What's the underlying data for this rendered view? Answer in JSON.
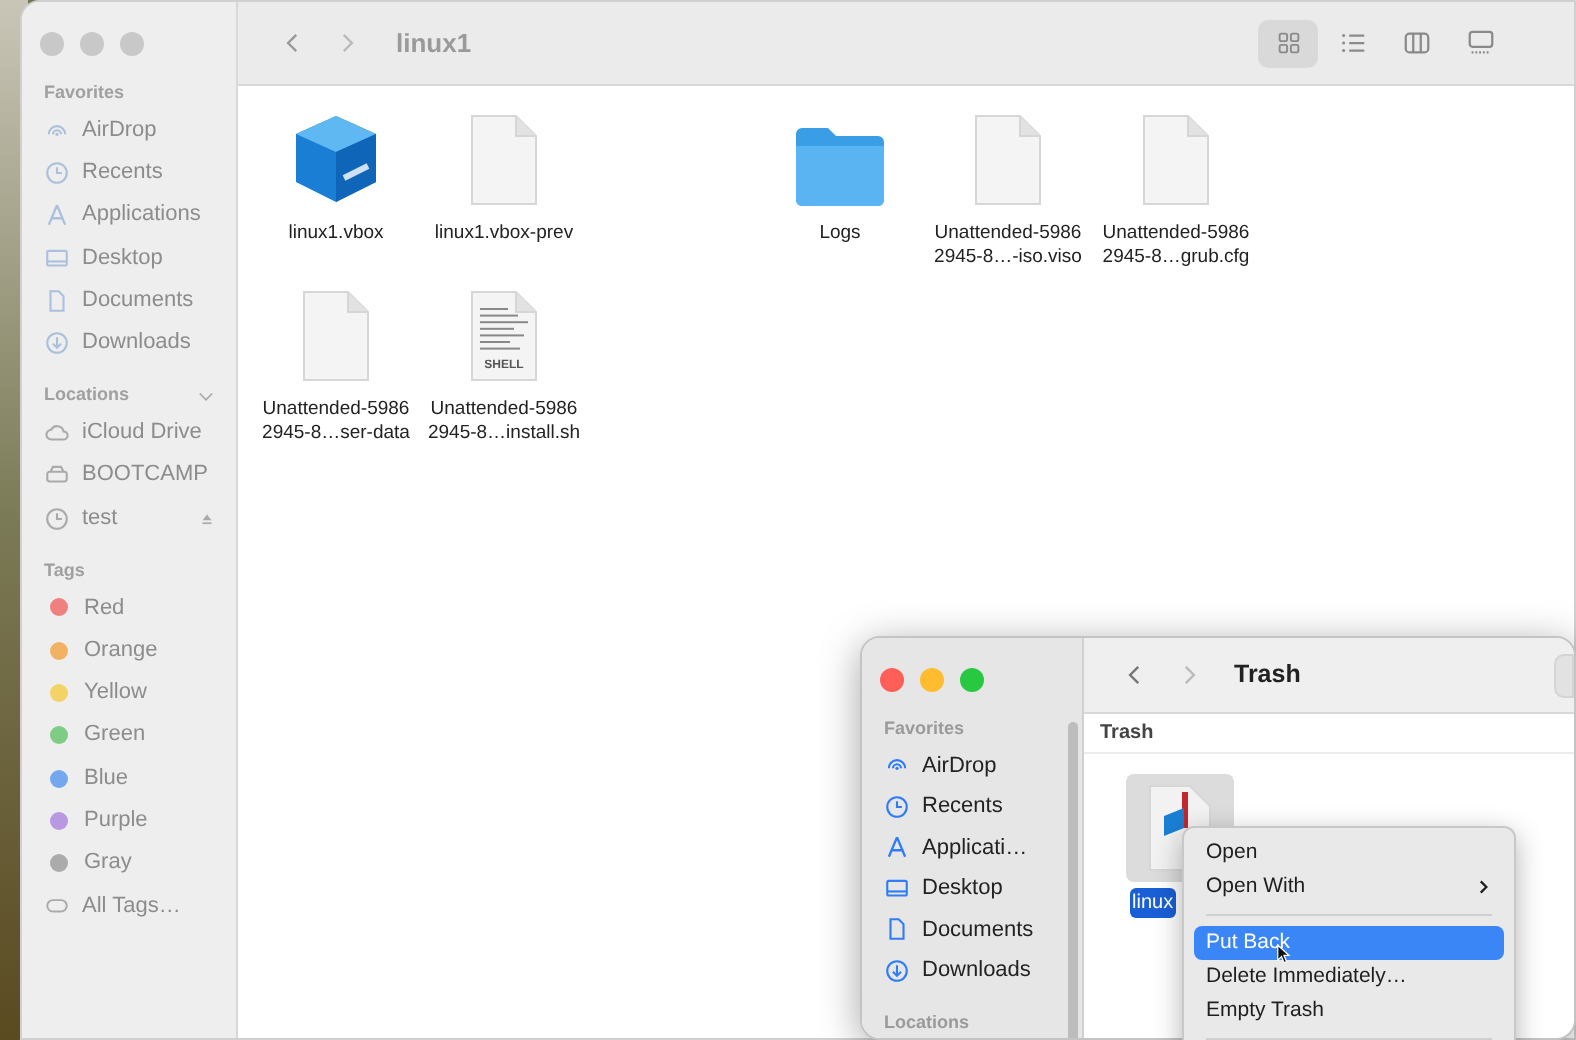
{
  "main_window": {
    "title": "linux1",
    "active": false,
    "view_modes": [
      {
        "selected": true
      },
      {
        "selected": false
      },
      {
        "selected": false
      },
      {
        "selected": false
      }
    ],
    "sidebar": {
      "sections": [
        {
          "title": "Favorites",
          "items": [
            {
              "label": "AirDrop"
            },
            {
              "label": "Recents"
            },
            {
              "label": "Applications"
            },
            {
              "label": "Desktop"
            },
            {
              "label": "Documents"
            },
            {
              "label": "Downloads"
            }
          ]
        },
        {
          "title": "Locations",
          "collapsible": true,
          "items": [
            {
              "label": "iCloud Drive"
            },
            {
              "label": "BOOTCAMP"
            },
            {
              "label": "test",
              "ejectable": true
            }
          ]
        },
        {
          "title": "Tags",
          "items": [
            {
              "label": "Red",
              "color": "#f08080"
            },
            {
              "label": "Orange",
              "color": "#f2b263"
            },
            {
              "label": "Yellow",
              "color": "#f3d365"
            },
            {
              "label": "Green",
              "color": "#7fcc85"
            },
            {
              "label": "Blue",
              "color": "#74a8ee"
            },
            {
              "label": "Purple",
              "color": "#b898e0"
            },
            {
              "label": "Gray",
              "color": "#ababab"
            },
            {
              "label": "All Tags…"
            }
          ]
        }
      ]
    },
    "files": [
      {
        "kind": "vbox",
        "name": [
          "linux1.vbox"
        ]
      },
      {
        "kind": "document",
        "name": [
          "linux1.vbox-prev"
        ]
      },
      {
        "kind": "folder",
        "name": [
          "Logs"
        ]
      },
      {
        "kind": "document",
        "name": [
          "Unattended-5986",
          "2945-8…-iso.viso"
        ]
      },
      {
        "kind": "document",
        "name": [
          "Unattended-5986",
          "2945-8…grub.cfg"
        ]
      },
      {
        "kind": "document",
        "name": [
          "Unattended-5986",
          "2945-8…ser-data"
        ]
      },
      {
        "kind": "shell",
        "name": [
          "Unattended-5986",
          "2945-8…install.sh"
        ],
        "badge": "SHELL"
      }
    ]
  },
  "trash_window": {
    "title": "Trash",
    "active": true,
    "path": "Trash",
    "sidebar": {
      "sections": [
        {
          "title": "Favorites",
          "items": [
            {
              "label": "AirDrop"
            },
            {
              "label": "Recents"
            },
            {
              "label": "Applicati…"
            },
            {
              "label": "Desktop"
            },
            {
              "label": "Documents"
            },
            {
              "label": "Downloads"
            }
          ]
        },
        {
          "title": "Locations"
        }
      ]
    },
    "files": [
      {
        "kind": "vbox-doc",
        "name": "linux",
        "selected": true
      }
    ]
  },
  "context_menu": {
    "items": [
      {
        "label": "Open",
        "submenu": false,
        "selected": false
      },
      {
        "label": "Open With",
        "submenu": true,
        "selected": false
      },
      {
        "kind": "separator"
      },
      {
        "label": "Put Back",
        "submenu": false,
        "selected": true
      },
      {
        "label": "Delete Immediately…",
        "submenu": false,
        "selected": false
      },
      {
        "label": "Empty Trash",
        "submenu": false,
        "selected": false
      },
      {
        "kind": "separator"
      }
    ]
  }
}
